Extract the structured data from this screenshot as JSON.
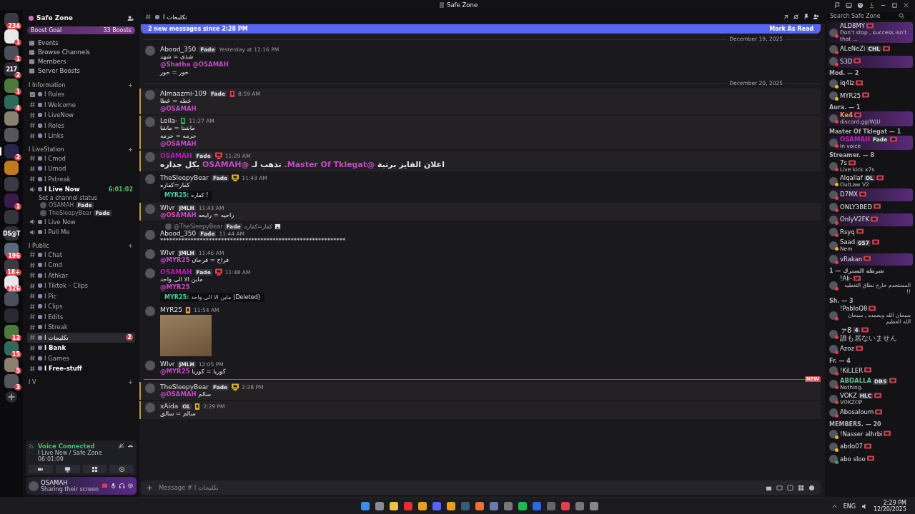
{
  "window": {
    "title": "Safe Zone"
  },
  "servers": [
    {
      "badge": "234",
      "selected": false
    },
    {
      "badge": "1",
      "selected": false
    },
    {
      "badge": "1",
      "selected": false
    },
    {
      "label": "217",
      "badge": "2",
      "selected": false
    },
    {
      "badge": "1",
      "selected": false
    },
    {
      "badge": "4",
      "selected": false
    },
    {
      "selected": false
    },
    {
      "selected": false
    },
    {
      "badge": "2",
      "selected": true
    },
    {
      "selected": false
    },
    {
      "selected": false
    },
    {
      "badge": "1",
      "selected": false
    },
    {
      "selected": false
    },
    {
      "label": "DS@T",
      "selected": false
    },
    {
      "badge": "196",
      "selected": false
    },
    {
      "badge": "18+",
      "selected": false
    },
    {
      "badge": "326",
      "selected": false
    },
    {
      "selected": false
    },
    {
      "selected": false
    },
    {
      "badge": "12",
      "selected": false
    },
    {
      "badge": "15",
      "selected": false
    },
    {
      "badge": "5",
      "selected": false
    },
    {
      "badge": "3",
      "selected": false
    }
  ],
  "sidebar": {
    "server_name": "Safe Zone",
    "boost_goal": "Boost Goal",
    "boosts": "33 Boosts",
    "nav": [
      "Events",
      "Browse Channels",
      "Members",
      "Server Boosts"
    ],
    "categories": [
      {
        "name": "I Information",
        "channels": [
          {
            "name": "I Rules",
            "kind": "rules",
            "unread": false,
            "selected": false
          },
          {
            "name": "I Welcome",
            "kind": "text",
            "unread": false,
            "selected": false
          },
          {
            "name": "I LiveNow",
            "kind": "text",
            "unread": false,
            "selected": false
          },
          {
            "name": "I Roles",
            "kind": "text",
            "unread": false,
            "selected": false
          },
          {
            "name": "I Links",
            "kind": "text",
            "unread": false,
            "selected": false
          }
        ]
      },
      {
        "name": "I LiveStation",
        "channels": [
          {
            "name": "I Cmod",
            "kind": "text",
            "unread": false,
            "selected": false
          },
          {
            "name": "I Umod",
            "kind": "text",
            "unread": false,
            "selected": false
          },
          {
            "name": "I Pstreak",
            "kind": "text",
            "unread": false,
            "selected": false
          },
          {
            "name": "I Live Now",
            "kind": "voice",
            "unread": true,
            "selected": false,
            "timer": "6:01:02",
            "status": "Set a channel status",
            "users": [
              {
                "name": "OSAMAH",
                "tag": "Fade"
              },
              {
                "name": "TheSleepyBear",
                "tag": "Fade"
              }
            ]
          },
          {
            "name": "I Live Now",
            "kind": "voice",
            "unread": false,
            "selected": false
          },
          {
            "name": "I Pull Me",
            "kind": "voice",
            "unread": false,
            "selected": false
          }
        ]
      },
      {
        "name": "I Public",
        "channels": [
          {
            "name": "I Chat",
            "kind": "text",
            "unread": false,
            "selected": false
          },
          {
            "name": "I Cmd",
            "kind": "text",
            "unread": false,
            "selected": false
          },
          {
            "name": "I Athkar",
            "kind": "text",
            "unread": false,
            "selected": false
          },
          {
            "name": "I Tiktok – Clips",
            "kind": "text",
            "unread": false,
            "selected": false
          },
          {
            "name": "I Pic",
            "kind": "text",
            "unread": false,
            "selected": false
          },
          {
            "name": "I Clips",
            "kind": "text",
            "unread": false,
            "selected": false
          },
          {
            "name": "I Edits",
            "kind": "text",
            "unread": false,
            "selected": false
          },
          {
            "name": "I Streak",
            "kind": "text",
            "unread": false,
            "selected": false
          },
          {
            "name": "I تكليجات",
            "kind": "text",
            "unread": false,
            "selected": true,
            "badge": "2"
          },
          {
            "name": "I Bank",
            "kind": "text",
            "unread": true,
            "selected": false
          },
          {
            "name": "I Games",
            "kind": "text",
            "unread": false,
            "selected": false
          },
          {
            "name": "I Free-stuff",
            "kind": "text",
            "unread": true,
            "selected": false
          }
        ]
      },
      {
        "name": "I V"
      }
    ]
  },
  "voice_panel": {
    "title": "Voice Connected",
    "channel": "I Live Now / Safe Zone",
    "elapsed": "06:01:09"
  },
  "user_panel": {
    "name": "OSAMAH",
    "status": "Sharing their screen"
  },
  "chat": {
    "channel": "I تكليجات",
    "new_bar": "2 new messages since 2:28 PM",
    "mark_read": "Mark As Read",
    "placeholder": "Message # I تكليجات",
    "items": [
      {
        "kind": "date",
        "label": "December 19, 2025"
      },
      {
        "kind": "message",
        "author": "Abood_350",
        "tag": "Fade",
        "time": "Yesterday at 12:16 PM",
        "highlighted": false,
        "lines": [
          [
            {
              "text": "شذى = شهد",
              "mention": false
            }
          ],
          [
            {
              "text": "@Shatha @OSAMAH",
              "mention": true
            }
          ],
          [
            {
              "text": "خور = حور",
              "mention": false
            }
          ]
        ]
      },
      {
        "kind": "date",
        "label": "December 20, 2025"
      },
      {
        "kind": "message",
        "author": "Almaazmi-109",
        "tag": "Fade",
        "device": {
          "kind": "phone",
          "color": "#e0404a"
        },
        "time": "8:59 AM",
        "highlighted": true,
        "lines": [
          [
            {
              "text": "عطه = عطا",
              "mention": false
            }
          ],
          [
            {
              "text": "@OSAMAH",
              "mention": true
            }
          ]
        ]
      },
      {
        "kind": "message",
        "author": "Leila-",
        "device": {
          "kind": "phone",
          "color": "#3ba55c"
        },
        "time": "11:27 AM",
        "highlighted": true,
        "lines": [
          [
            {
              "text": "ماشتا = ماشا",
              "mention": false
            }
          ],
          [
            {
              "text": "حرمه = حرمه",
              "mention": false
            }
          ],
          [
            {
              "text": "@OSAMAH",
              "mention": true
            }
          ]
        ]
      },
      {
        "kind": "message",
        "author": "OSAMAH",
        "color": "#b41cae",
        "tag": "Fade",
        "device": {
          "kind": "desktop",
          "color": "#e0404a"
        },
        "time": "11:29 AM",
        "highlighted": true,
        "big": true,
        "lines": [
          [
            {
              "text": "اعلان الفايز برتبة",
              "mention": false
            },
            {
              "text": "@Master Of Tklegat.",
              "mention": true
            },
            {
              "text": "تذهب لـ",
              "mention": false
            },
            {
              "text": "@OSAMAH",
              "mention": true
            },
            {
              "text": "بكل جداره",
              "mention": false
            }
          ]
        ]
      },
      {
        "kind": "message",
        "author": "TheSleepyBear",
        "tag": "Fade",
        "device": {
          "kind": "desktop",
          "color": "#e0b030"
        },
        "time": "11:43 AM",
        "highlighted": false,
        "lines": [
          [
            {
              "text": "كفار=كفاره",
              "mention": false
            }
          ]
        ],
        "embed": {
          "author": "MYR25:",
          "text": "كفاره !",
          "deleted": false
        }
      },
      {
        "kind": "message",
        "author": "Wlvr",
        "tag": "JMLH",
        "time": "11:43 AM",
        "highlighted": true,
        "lines": [
          [
            {
              "text": "@OSAMAH",
              "mention": true
            },
            {
              "text": "راحيه = رايحه",
              "mention": false
            }
          ]
        ]
      },
      {
        "kind": "message",
        "author": "Abood_350",
        "tag": "Fade",
        "time": "11:44 AM",
        "highlighted": false,
        "reply": {
          "author": "@TheSleepyBear",
          "tag": "Fade",
          "text": "كفار=كفاره"
        },
        "lines": [
          [
            {
              "text": "*************************************************************",
              "mention": false
            }
          ]
        ]
      },
      {
        "kind": "message",
        "author": "Wlvr",
        "tag": "JMLH",
        "time": "11:46 AM",
        "highlighted": false,
        "lines": [
          [
            {
              "text": "@MYR25",
              "mention": true
            },
            {
              "text": "فراح = فرحان",
              "mention": false
            }
          ]
        ]
      },
      {
        "kind": "message",
        "author": "OSAMAH",
        "color": "#b41cae",
        "tag": "Fade",
        "device": {
          "kind": "desktop",
          "color": "#e0404a"
        },
        "time": "11:48 AM",
        "highlighted": false,
        "lines": [
          [
            {
              "text": "ماين الا الى واحد",
              "mention": false
            }
          ],
          [
            {
              "text": "@MYR25",
              "mention": true
            }
          ]
        ],
        "embed": {
          "author": "MYR25:",
          "text": "ماين الا الى واحد",
          "deleted": true,
          "deleted_label": "(Deleted)"
        }
      },
      {
        "kind": "message",
        "author": "MYR25",
        "device": {
          "kind": "phone",
          "color": "#e0b030"
        },
        "time": "11:54 AM",
        "highlighted": false,
        "image": true
      },
      {
        "kind": "message",
        "author": "Wlvr",
        "tag": "JMLH",
        "time": "12:05 PM",
        "highlighted": false,
        "lines": [
          [
            {
              "text": "@MYR25",
              "mention": true
            },
            {
              "text": "كوريا = كوريا",
              "mention": false
            }
          ]
        ]
      },
      {
        "kind": "new",
        "label": "NEW"
      },
      {
        "kind": "message",
        "author": "TheSleepyBear",
        "tag": "Fade",
        "device": {
          "kind": "desktop",
          "color": "#e0b030"
        },
        "time": "2:28 PM",
        "highlighted": true,
        "lines": [
          [
            {
              "text": "@OSAMAH",
              "mention": true
            },
            {
              "text": "سالم",
              "mention": false
            }
          ]
        ]
      },
      {
        "kind": "message",
        "author": "xAida",
        "tag": "OL",
        "device": {
          "kind": "phone",
          "color": "#e0b030"
        },
        "time": "2:29 PM",
        "highlighted": true,
        "lines": [
          [
            {
              "text": "سالم = سالق",
              "mention": false
            }
          ]
        ]
      }
    ]
  },
  "members": {
    "search_placeholder": "Search Safe Zone",
    "groups": [
      {
        "members": [
          {
            "name": "ALD8MY",
            "presence": {
              "color": "#e0404a"
            },
            "activity": "Don't stop , success isn't that ...",
            "nameplate": true
          },
          {
            "name": "ALeNeZi",
            "presence": {
              "color": "#e0404a"
            },
            "tag": "CHL",
            "nameplate": false
          },
          {
            "name": "S3D",
            "presence": {
              "color": "#e0404a"
            },
            "nameplate": true
          }
        ]
      },
      {
        "title": "Mod. — 2",
        "members": [
          {
            "name": "iq4lz",
            "presence": {
              "color": "#f0b232"
            },
            "nameplate": false
          },
          {
            "name": "MYR25",
            "presence": {
              "color": "#f0b232"
            },
            "nameplate": false
          }
        ]
      },
      {
        "title": "Aura. — 1",
        "members": [
          {
            "name": "Ke4",
            "color": "#f0a030",
            "presence": {
              "color": "#e0404a"
            },
            "activity": "discord.gg/WJU",
            "nameplate": true
          }
        ]
      },
      {
        "title": "Master Of Tklegat — 1",
        "members": [
          {
            "name": "OSAMAH",
            "color": "#c020b8",
            "presence": {
              "color": "#e0404a"
            },
            "tag": "Fade",
            "activity": "In voice",
            "nameplate": true
          }
        ]
      },
      {
        "title": "Streamer. — 8",
        "members": [
          {
            "name": "7s",
            "presence": {
              "color": "#e0404a"
            },
            "activity": "Live kick x7s",
            "nameplate": false
          },
          {
            "name": "Alqallaf",
            "presence": {
              "color": "#f0b232"
            },
            "tag": "OL",
            "activity": "OutLaw V2",
            "nameplate": false
          },
          {
            "name": "D7MX",
            "presence": {
              "color": "#e0404a"
            },
            "nameplate": true
          },
          {
            "name": "ONLY3BED",
            "presence": {
              "color": "#e0404a"
            },
            "nameplate": false
          },
          {
            "name": "OnlyV2FK",
            "presence": {
              "color": "#e0404a"
            },
            "nameplate": true
          },
          {
            "name": "Rsyq",
            "presence": {
              "color": "#e0404a"
            },
            "nameplate": false
          },
          {
            "name": "Saad",
            "presence": {
              "color": "#f0b232"
            },
            "tag": "057",
            "activity": "Nem",
            "nameplate": false
          },
          {
            "name": "vRakan",
            "presence": {
              "color": "#e0404a"
            },
            "nameplate": true
          }
        ]
      },
      {
        "title": "شرطة السترك — 1",
        "members": [
          {
            "name": "!Ali-",
            "presence": {
              "color": "#e0404a"
            },
            "activity": "المستخدم خارج نطاق التغطيه !!",
            "nameplate": false
          }
        ]
      },
      {
        "title": "Sh. — 3",
        "members": [
          {
            "name": "!PabloQ8",
            "presence": {
              "color": "#e0404a"
            },
            "activity": "سبحان الله وبحمده , سبحان الله العظيم",
            "nameplate": false
          },
          {
            "name": "ァ8",
            "cjk": true,
            "presence": {
              "color": "#e0404a"
            },
            "tag": "4",
            "activity": "誰も居ないません",
            "nameplate": false
          },
          {
            "name": "Azoz",
            "presence": {
              "color": "#e0404a"
            },
            "nameplate": false
          }
        ]
      },
      {
        "title": "Fr. — 4",
        "members": [
          {
            "name": "!KiLLER",
            "presence": {
              "color": "#e0404a"
            },
            "nameplate": false
          },
          {
            "name": "ABDALLA",
            "color": "#5fc090",
            "presence": {
              "color": "#e0404a"
            },
            "tag": "DBS",
            "activity": "Nothing.",
            "nameplate": false
          },
          {
            "name": "VOKZ",
            "presence": {
              "color": "#e0404a"
            },
            "tag": "HLC",
            "activity": "VOKZOP",
            "nameplate": false
          },
          {
            "name": "Abosaloum",
            "presence": {
              "color": "#e0404a"
            },
            "nameplate": false
          }
        ]
      },
      {
        "title": "MEMBERS. — 20",
        "members": [
          {
            "name": "!Nasser alhrbi",
            "presence": {
              "color": "#f0b232"
            },
            "nameplate": false
          },
          {
            "name": "abdo07",
            "presence": {
              "color": "#f0b232"
            },
            "nameplate": false
          },
          {
            "name": "abo sloo",
            "presence": {
              "color": "#3ba55c"
            },
            "nameplate": false
          }
        ]
      }
    ]
  },
  "taskbar": {
    "language": "ENG",
    "time": "2:29 PM",
    "date": "12/20/2025"
  }
}
